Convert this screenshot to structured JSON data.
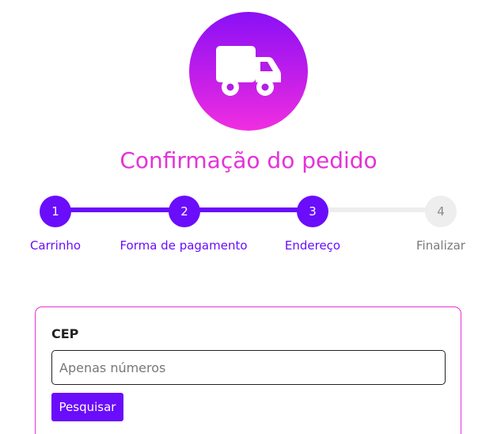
{
  "hero": {
    "icon": "truck-icon",
    "gradient_top": "#8a10f6",
    "gradient_bottom": "#f02ee0"
  },
  "title": "Confirmação do pedido",
  "colors": {
    "accent": "#6a0dfb",
    "title": "#e432d9",
    "inactive": "#eeeeee"
  },
  "stepper": {
    "current_step": 3,
    "steps": [
      {
        "number": "1",
        "label": "Carrinho",
        "state": "completed"
      },
      {
        "number": "2",
        "label": "Forma de pagamento",
        "state": "completed"
      },
      {
        "number": "3",
        "label": "Endereço",
        "state": "current"
      },
      {
        "number": "4",
        "label": "Finalizar",
        "state": "pending"
      }
    ]
  },
  "form": {
    "cep_label": "CEP",
    "cep_value": "",
    "cep_placeholder": "Apenas números",
    "search_label": "Pesquisar"
  }
}
